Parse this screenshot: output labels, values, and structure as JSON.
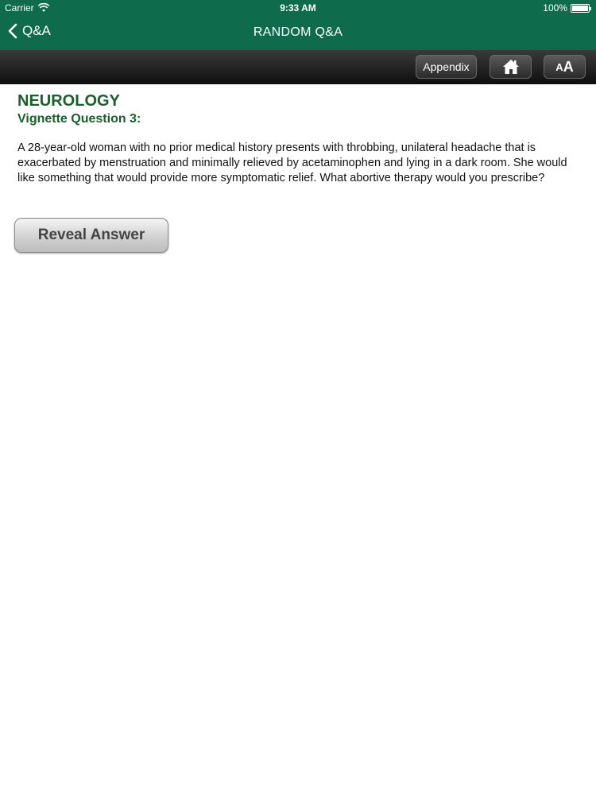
{
  "status_bar": {
    "carrier": "Carrier",
    "wifi_icon": "wifi-icon",
    "time": "9:33 AM",
    "battery": "100%",
    "battery_icon": "battery-icon",
    "battery_level": 1.0
  },
  "nav": {
    "back_label": "Q&A",
    "back_icon": "chevron-left-icon",
    "title": "RANDOM Q&A",
    "color": "#0e6b4c"
  },
  "toolbar": {
    "appendix_label": "Appendix",
    "home_icon": "home-icon",
    "fontsize_small": "A",
    "fontsize_big": "A"
  },
  "main": {
    "category": "NEUROLOGY",
    "question_heading": "Vignette Question 3:",
    "question_text": "A 28-year-old woman with no prior medical history presents with throbbing, unilateral headache that is exacerbated by menstruation and minimally relieved by acetaminophen and lying in a dark room. She would like something that would provide more symptomatic relief. What abortive therapy would you prescribe?",
    "reveal_label": "Reveal Answer",
    "accent_color": "#1a5e2b"
  }
}
